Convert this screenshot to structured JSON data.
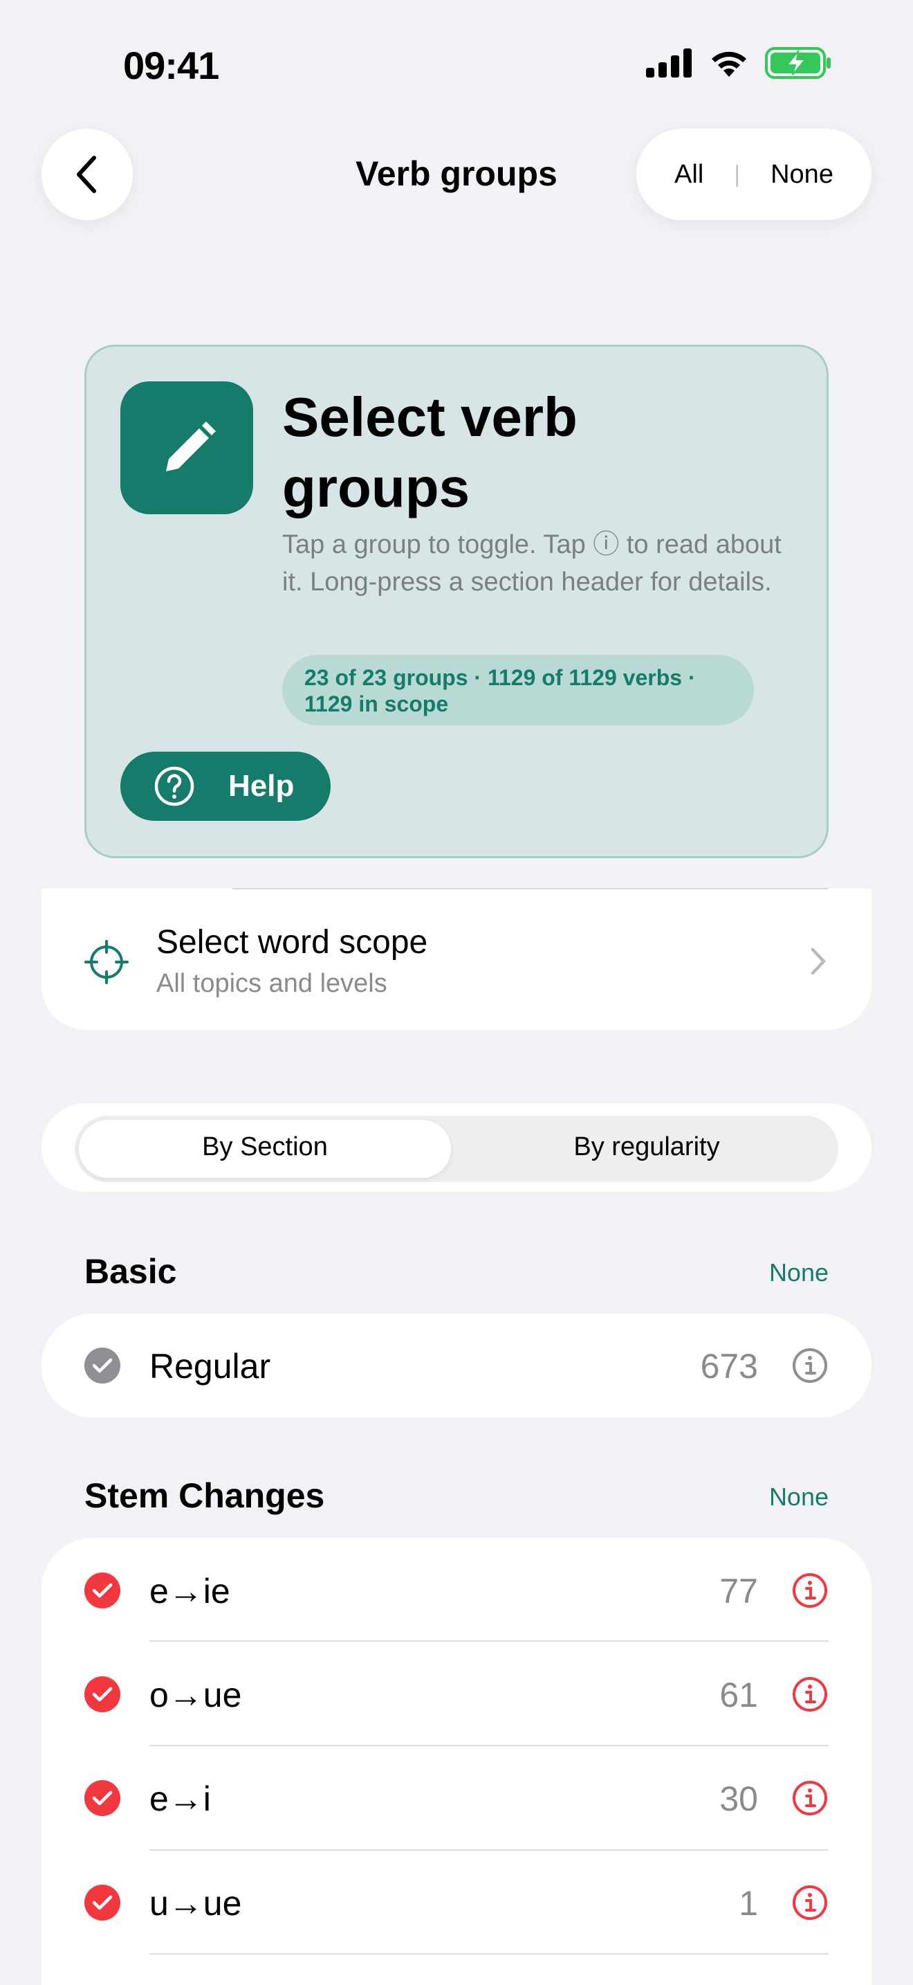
{
  "status_bar": {
    "time": "09:41"
  },
  "nav": {
    "title": "Verb groups",
    "all_label": "All",
    "separator": "|",
    "none_label": "None"
  },
  "hero": {
    "title": "Select verb groups",
    "description": "Tap a group to toggle. Tap ⓘ to read about it. Long-press a section header for details.",
    "summary": "23 of 23 groups · 1129 of 1129 verbs · 1129 in scope",
    "help_label": "Help"
  },
  "scope": {
    "title": "Select word scope",
    "subtitle": "All topics and levels"
  },
  "segmented": {
    "options": [
      "By Section",
      "By regularity"
    ],
    "selected": "By Section"
  },
  "sections": [
    {
      "title": "Basic",
      "action": "None",
      "rows": [
        {
          "label": "Regular",
          "count": "673",
          "checked": true,
          "color": "#8e8e93"
        }
      ]
    },
    {
      "title": "Stem Changes",
      "action": "None",
      "rows": [
        {
          "label": "e→ie",
          "count": "77",
          "checked": true,
          "color": "#f2383f"
        },
        {
          "label": "o→ue",
          "count": "61",
          "checked": true,
          "color": "#f2383f"
        },
        {
          "label": "e→i",
          "count": "30",
          "checked": true,
          "color": "#f2383f"
        },
        {
          "label": "u→ue",
          "count": "1",
          "checked": true,
          "color": "#f2383f"
        }
      ]
    }
  ],
  "colors": {
    "accent": "#157b6a",
    "stem_accent": "#f2383f",
    "regular_accent": "#8e8e93"
  }
}
